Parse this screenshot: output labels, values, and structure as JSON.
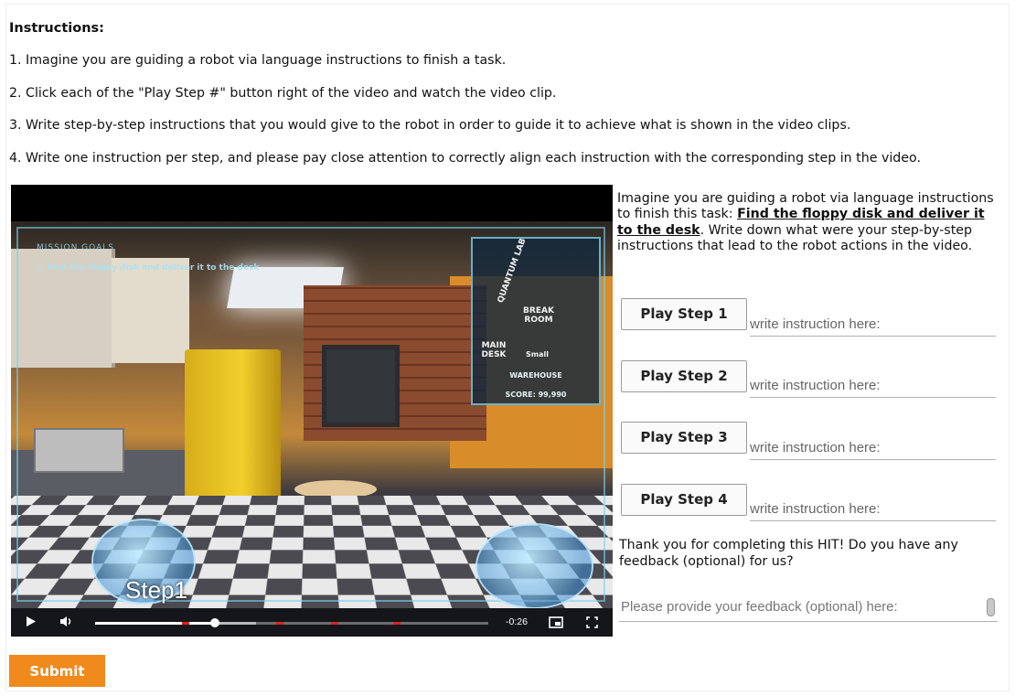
{
  "instructions": {
    "title": "Instructions:",
    "lines": [
      "1. Imagine you are guiding a robot via language instructions to finish a task.",
      "2. Click each of the \"Play Step #\" button right of the video and watch the video clip.",
      "3. Write step-by-step instructions that you would give to the robot in order to guide it to achieve what is shown in the video clips.",
      "4. Write one instruction per step, and please pay close attention to correctly align each instruction with the corresponding step in the video."
    ]
  },
  "video": {
    "hud_mission": "MISSION GOALS",
    "hud_task": "Find the floppy disk and deliver it to the desk",
    "minimap": {
      "rooms": [
        "QUANTUM LAB",
        "BREAK ROOM",
        "MAIN DESK",
        "Small"
      ],
      "location": "WAREHOUSE",
      "score": "SCORE: 99,990"
    },
    "overlay_text": "Step1",
    "time_remaining": "-0:26",
    "progress_fraction": 0.305,
    "icons": {
      "play": "play-icon",
      "volume": "volume-icon",
      "pip": "picture-in-picture-icon",
      "fullscreen": "fullscreen-icon"
    }
  },
  "panel": {
    "intro_before": "Imagine you are guiding a robot via language instructions to finish this task: ",
    "task": "Find the floppy disk and deliver it to the desk",
    "intro_after": ". Write down what were your step-by-step instructions that lead to the robot actions in the video.",
    "steps": [
      {
        "button": "Play Step 1",
        "placeholder": "write instruction here:"
      },
      {
        "button": "Play Step 2",
        "placeholder": "write instruction here:"
      },
      {
        "button": "Play Step 3",
        "placeholder": "write instruction here:"
      },
      {
        "button": "Play Step 4",
        "placeholder": "write instruction here:"
      }
    ],
    "feedback_question": "Thank you for completing this HIT! Do you have any feedback (optional) for us?",
    "feedback_placeholder": "Please provide your feedback (optional) here:"
  },
  "submit_label": "Submit",
  "colors": {
    "submit_bg": "#f08a1c",
    "progress_marker": "#e02020"
  }
}
